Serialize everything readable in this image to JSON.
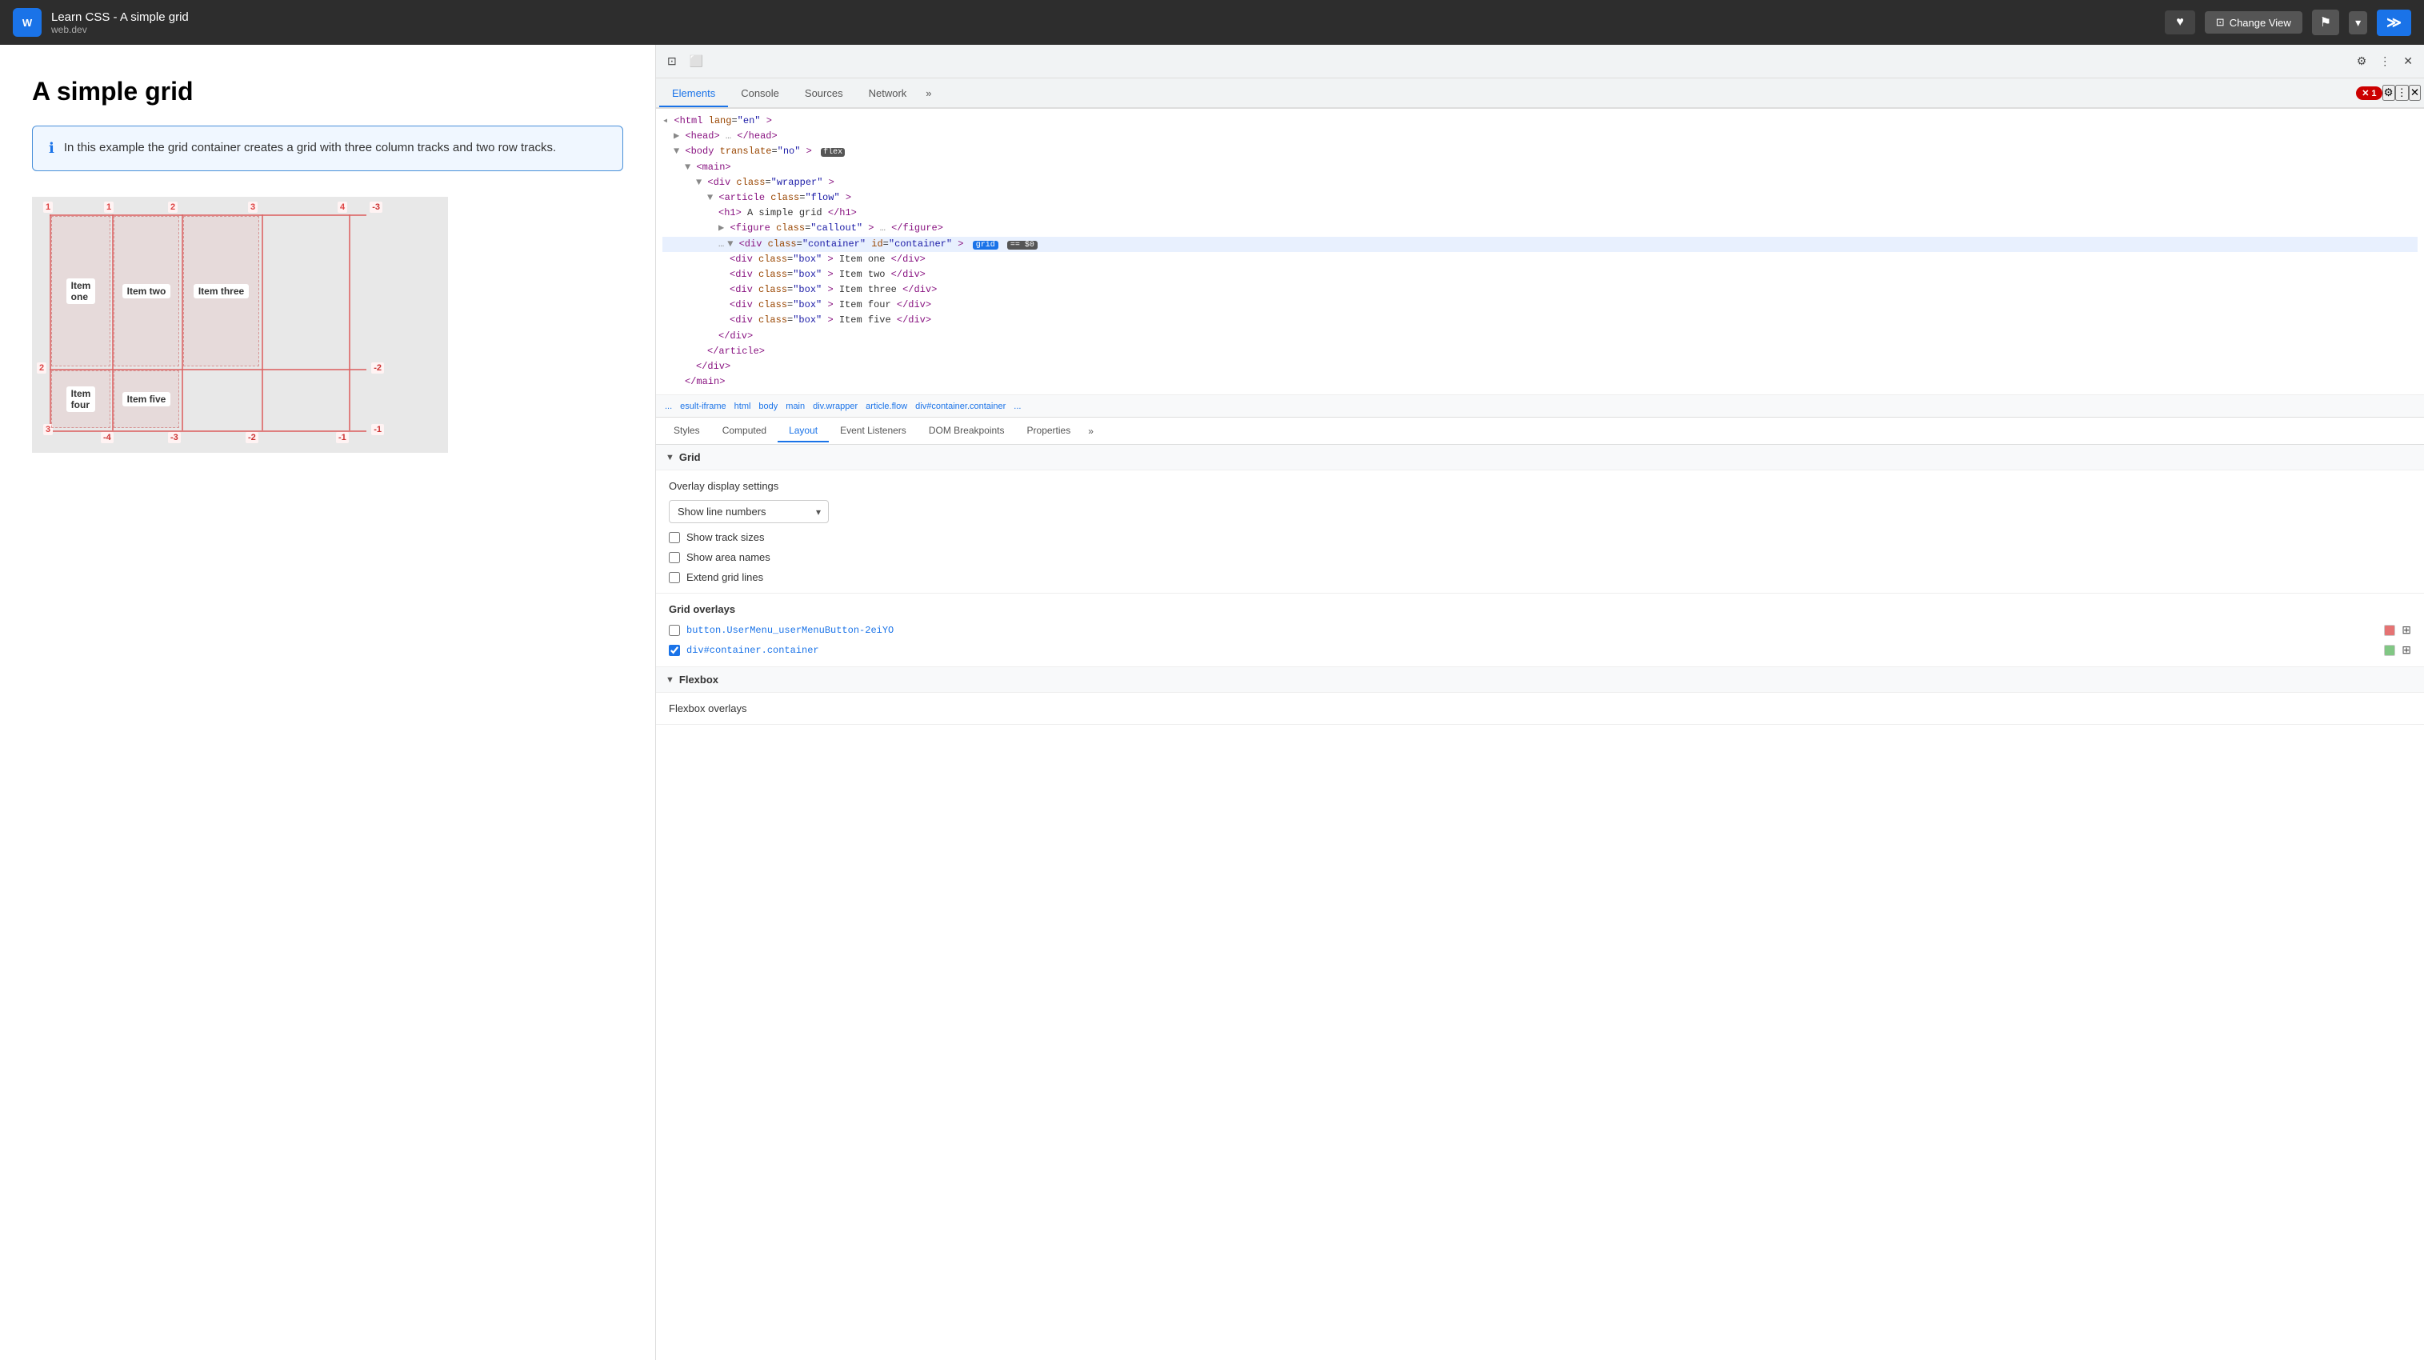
{
  "topbar": {
    "logo_text": "W",
    "page_title": "Learn CSS - A simple grid",
    "page_sub": "web.dev",
    "heart_label": "♥",
    "change_view_label": "Change View",
    "bookmark_label": "⚑",
    "chevron_label": "▾",
    "terminal_label": "≫"
  },
  "page": {
    "heading": "A simple grid",
    "info_text": "In this example the grid container creates a grid with three column tracks and two row tracks."
  },
  "devtools": {
    "tabs": [
      {
        "id": "elements",
        "label": "Elements",
        "active": true
      },
      {
        "id": "console",
        "label": "Console",
        "active": false
      },
      {
        "id": "sources",
        "label": "Sources",
        "active": false
      },
      {
        "id": "network",
        "label": "Network",
        "active": false
      }
    ],
    "error_count": "1",
    "html_tree": {
      "lines": [
        {
          "indent": 0,
          "content": "◂<html lang=\"en\">"
        },
        {
          "indent": 1,
          "content": "▶<head>…</head>"
        },
        {
          "indent": 1,
          "content": "▼<body translate=\"no\">",
          "badge": "flex"
        },
        {
          "indent": 2,
          "content": "▼<main>"
        },
        {
          "indent": 3,
          "content": "▼<div class=\"wrapper\">"
        },
        {
          "indent": 4,
          "content": "▼<article class=\"flow\">"
        },
        {
          "indent": 5,
          "content": "<h1>A simple grid</h1>"
        },
        {
          "indent": 5,
          "content": "▶<figure class=\"callout\">…</figure>"
        },
        {
          "indent": 5,
          "content": "▼<div class=\"container\" id=\"container\">",
          "selected": true,
          "badge": "grid",
          "s0": "== $0"
        },
        {
          "indent": 6,
          "content": "<div class=\"box\">Item one</div>"
        },
        {
          "indent": 6,
          "content": "<div class=\"box\">Item two</div>"
        },
        {
          "indent": 6,
          "content": "<div class=\"box\">Item three</div>"
        },
        {
          "indent": 6,
          "content": "<div class=\"box\">Item four</div>"
        },
        {
          "indent": 6,
          "content": "<div class=\"box\">Item five</div>"
        },
        {
          "indent": 5,
          "content": "</div>"
        },
        {
          "indent": 4,
          "content": "</article>"
        },
        {
          "indent": 3,
          "content": "</div>"
        },
        {
          "indent": 2,
          "content": "</main>"
        }
      ]
    },
    "breadcrumb": [
      "...",
      "esult-iframe",
      "html",
      "body",
      "main",
      "div.wrapper",
      "article.flow",
      "div#container.container",
      "..."
    ],
    "sub_tabs": [
      "Styles",
      "Computed",
      "Layout",
      "Event Listeners",
      "DOM Breakpoints",
      "Properties",
      "»"
    ],
    "active_sub_tab": "Layout",
    "layout": {
      "grid_section_title": "Grid",
      "overlay_display_label": "Overlay display settings",
      "dropdown_value": "Show line numbers",
      "dropdown_options": [
        "Show line numbers",
        "Show track sizes",
        "Show area names"
      ],
      "checkboxes": [
        {
          "id": "show-track-sizes",
          "label": "Show track sizes",
          "checked": false
        },
        {
          "id": "show-area-names",
          "label": "Show area names",
          "checked": false
        },
        {
          "id": "extend-grid-lines",
          "label": "Extend grid lines",
          "checked": false
        }
      ],
      "grid_overlays_title": "Grid overlays",
      "overlays": [
        {
          "id": "btn-overlay",
          "label": "button.UserMenu_userMenuButton-2eiYO",
          "checked": false,
          "color": "#e57373"
        },
        {
          "id": "div-overlay",
          "label": "div#container.container",
          "checked": true,
          "color": "#81c784"
        }
      ],
      "flexbox_title": "Flexbox",
      "flexbox_overlays_title": "Flexbox overlays"
    }
  }
}
